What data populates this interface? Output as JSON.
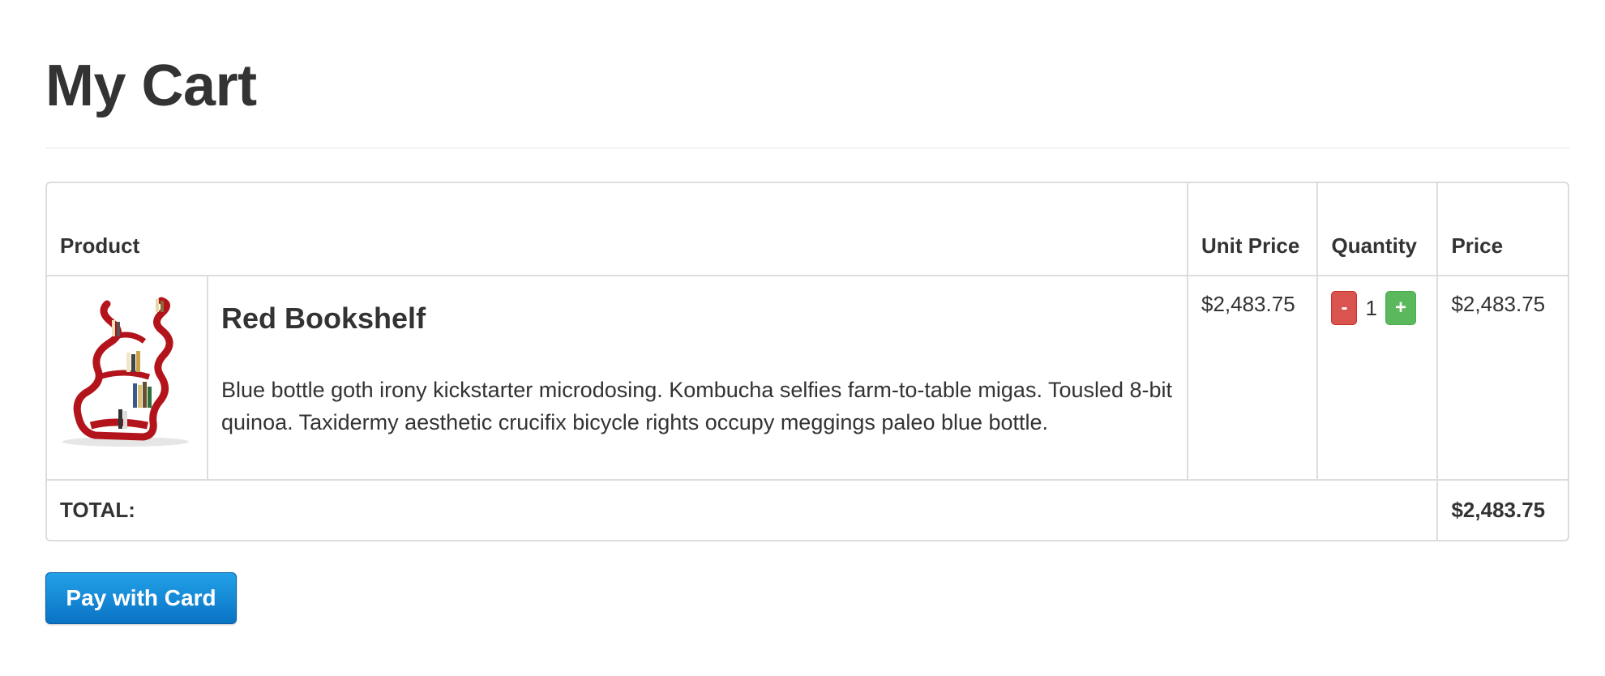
{
  "page": {
    "title": "My Cart"
  },
  "table": {
    "headers": {
      "product": "Product",
      "unit_price": "Unit Price",
      "quantity": "Quantity",
      "price": "Price"
    },
    "items": [
      {
        "name": "Red Bookshelf",
        "description": "Blue bottle goth irony kickstarter microdosing. Kombucha selfies farm-to-table migas. Tousled 8-bit quinoa. Taxidermy aesthetic crucifix bicycle rights occupy meggings paleo blue bottle.",
        "unit_price": "$2,483.75",
        "quantity": "1",
        "price": "$2,483.75",
        "decrement_label": "-",
        "increment_label": "+",
        "image_icon": "red-bookshelf-image"
      }
    ],
    "total": {
      "label": "TOTAL:",
      "value": "$2,483.75"
    }
  },
  "actions": {
    "pay_label": "Pay with Card"
  },
  "colors": {
    "minus_button": "#d9534f",
    "plus_button": "#5cb85c",
    "pay_button": "#1a8fdb",
    "border": "#dddddd",
    "text": "#333333"
  }
}
